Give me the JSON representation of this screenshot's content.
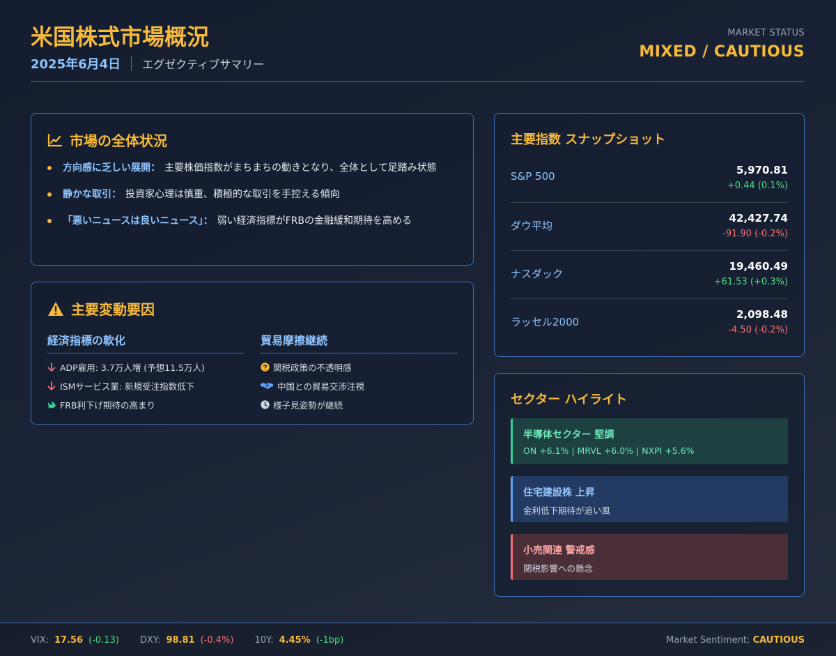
{
  "header": {
    "title": "米国株式市場概況",
    "date": "2025年6月4日",
    "subtitle": "エグゼクティブサマリー",
    "status_label": "MARKET STATUS",
    "status_value": "MIXED / CAUTIOUS"
  },
  "overview": {
    "title": "市場の全体状況",
    "icon": "line-chart-icon",
    "items": [
      {
        "label": "方向感に乏しい展開：",
        "text": "主要株価指数がまちまちの動きとなり、全体として足踏み状態"
      },
      {
        "label": "静かな取引：",
        "text": "投資家心理は慎重、積極的な取引を手控える傾向"
      },
      {
        "label": "「悪いニュースは良いニュース」：",
        "text": "弱い経済指標がFRBの金融緩和期待を高める"
      }
    ]
  },
  "drivers": {
    "title": "主要変動要因",
    "icon": "warning-icon",
    "economic": {
      "title": "経済指標の軟化",
      "items": [
        {
          "icon": "arrow-down-icon",
          "text": "ADP雇用: 3.7万人増 (予想11.5万人)"
        },
        {
          "icon": "arrow-down-icon",
          "text": "ISMサービス業: 新規受注指数低下"
        },
        {
          "icon": "dove-icon",
          "text": "FRB利下げ期待の高まり"
        }
      ]
    },
    "trade": {
      "title": "貿易摩擦継続",
      "items": [
        {
          "icon": "question-circle-icon",
          "text": "関税政策の不透明感"
        },
        {
          "icon": "handshake-icon",
          "text": "中国との貿易交渉注視"
        },
        {
          "icon": "clock-icon",
          "text": "様子見姿勢が継続"
        }
      ]
    }
  },
  "indices": {
    "title": "主要指数 スナップショット",
    "rows": [
      {
        "name": "S&P 500",
        "value": "5,970.81",
        "change": "+0.44 (0.1%)",
        "direction": "up"
      },
      {
        "name": "ダウ平均",
        "value": "42,427.74",
        "change": "-91.90 (-0.2%)",
        "direction": "down"
      },
      {
        "name": "ナスダック",
        "value": "19,460.49",
        "change": "+61.53 (+0.3%)",
        "direction": "up"
      },
      {
        "name": "ラッセル2000",
        "value": "2,098.48",
        "change": "-4.50 (-0.2%)",
        "direction": "down"
      }
    ]
  },
  "sectors": {
    "title": "セクター ハイライト",
    "items": [
      {
        "title": "半導体セクター 堅調",
        "detail": "ON +6.1% | MRVL +6.0% | NXPI +5.6%",
        "tone": "green"
      },
      {
        "title": "住宅建設株 上昇",
        "detail": "金利低下期待が追い風",
        "tone": "blue"
      },
      {
        "title": "小売関連 警戒感",
        "detail": "関税影響への懸念",
        "tone": "red"
      }
    ]
  },
  "footer": {
    "metrics": [
      {
        "label": "VIX:",
        "value": "17.56",
        "change": "(-0.13)",
        "direction": "up"
      },
      {
        "label": "DXY:",
        "value": "98.81",
        "change": "(-0.4%)",
        "direction": "down"
      },
      {
        "label": "10Y:",
        "value": "4.45%",
        "change": "(-1bp)",
        "direction": "up"
      }
    ],
    "sentiment_label": "Market Sentiment:",
    "sentiment_value": "CAUTIOUS"
  },
  "colors": {
    "accent": "#f6b93b",
    "label_blue": "#8ec5ff",
    "border": "#3f6fb8",
    "positive": "#4ade80",
    "negative": "#f87171"
  }
}
